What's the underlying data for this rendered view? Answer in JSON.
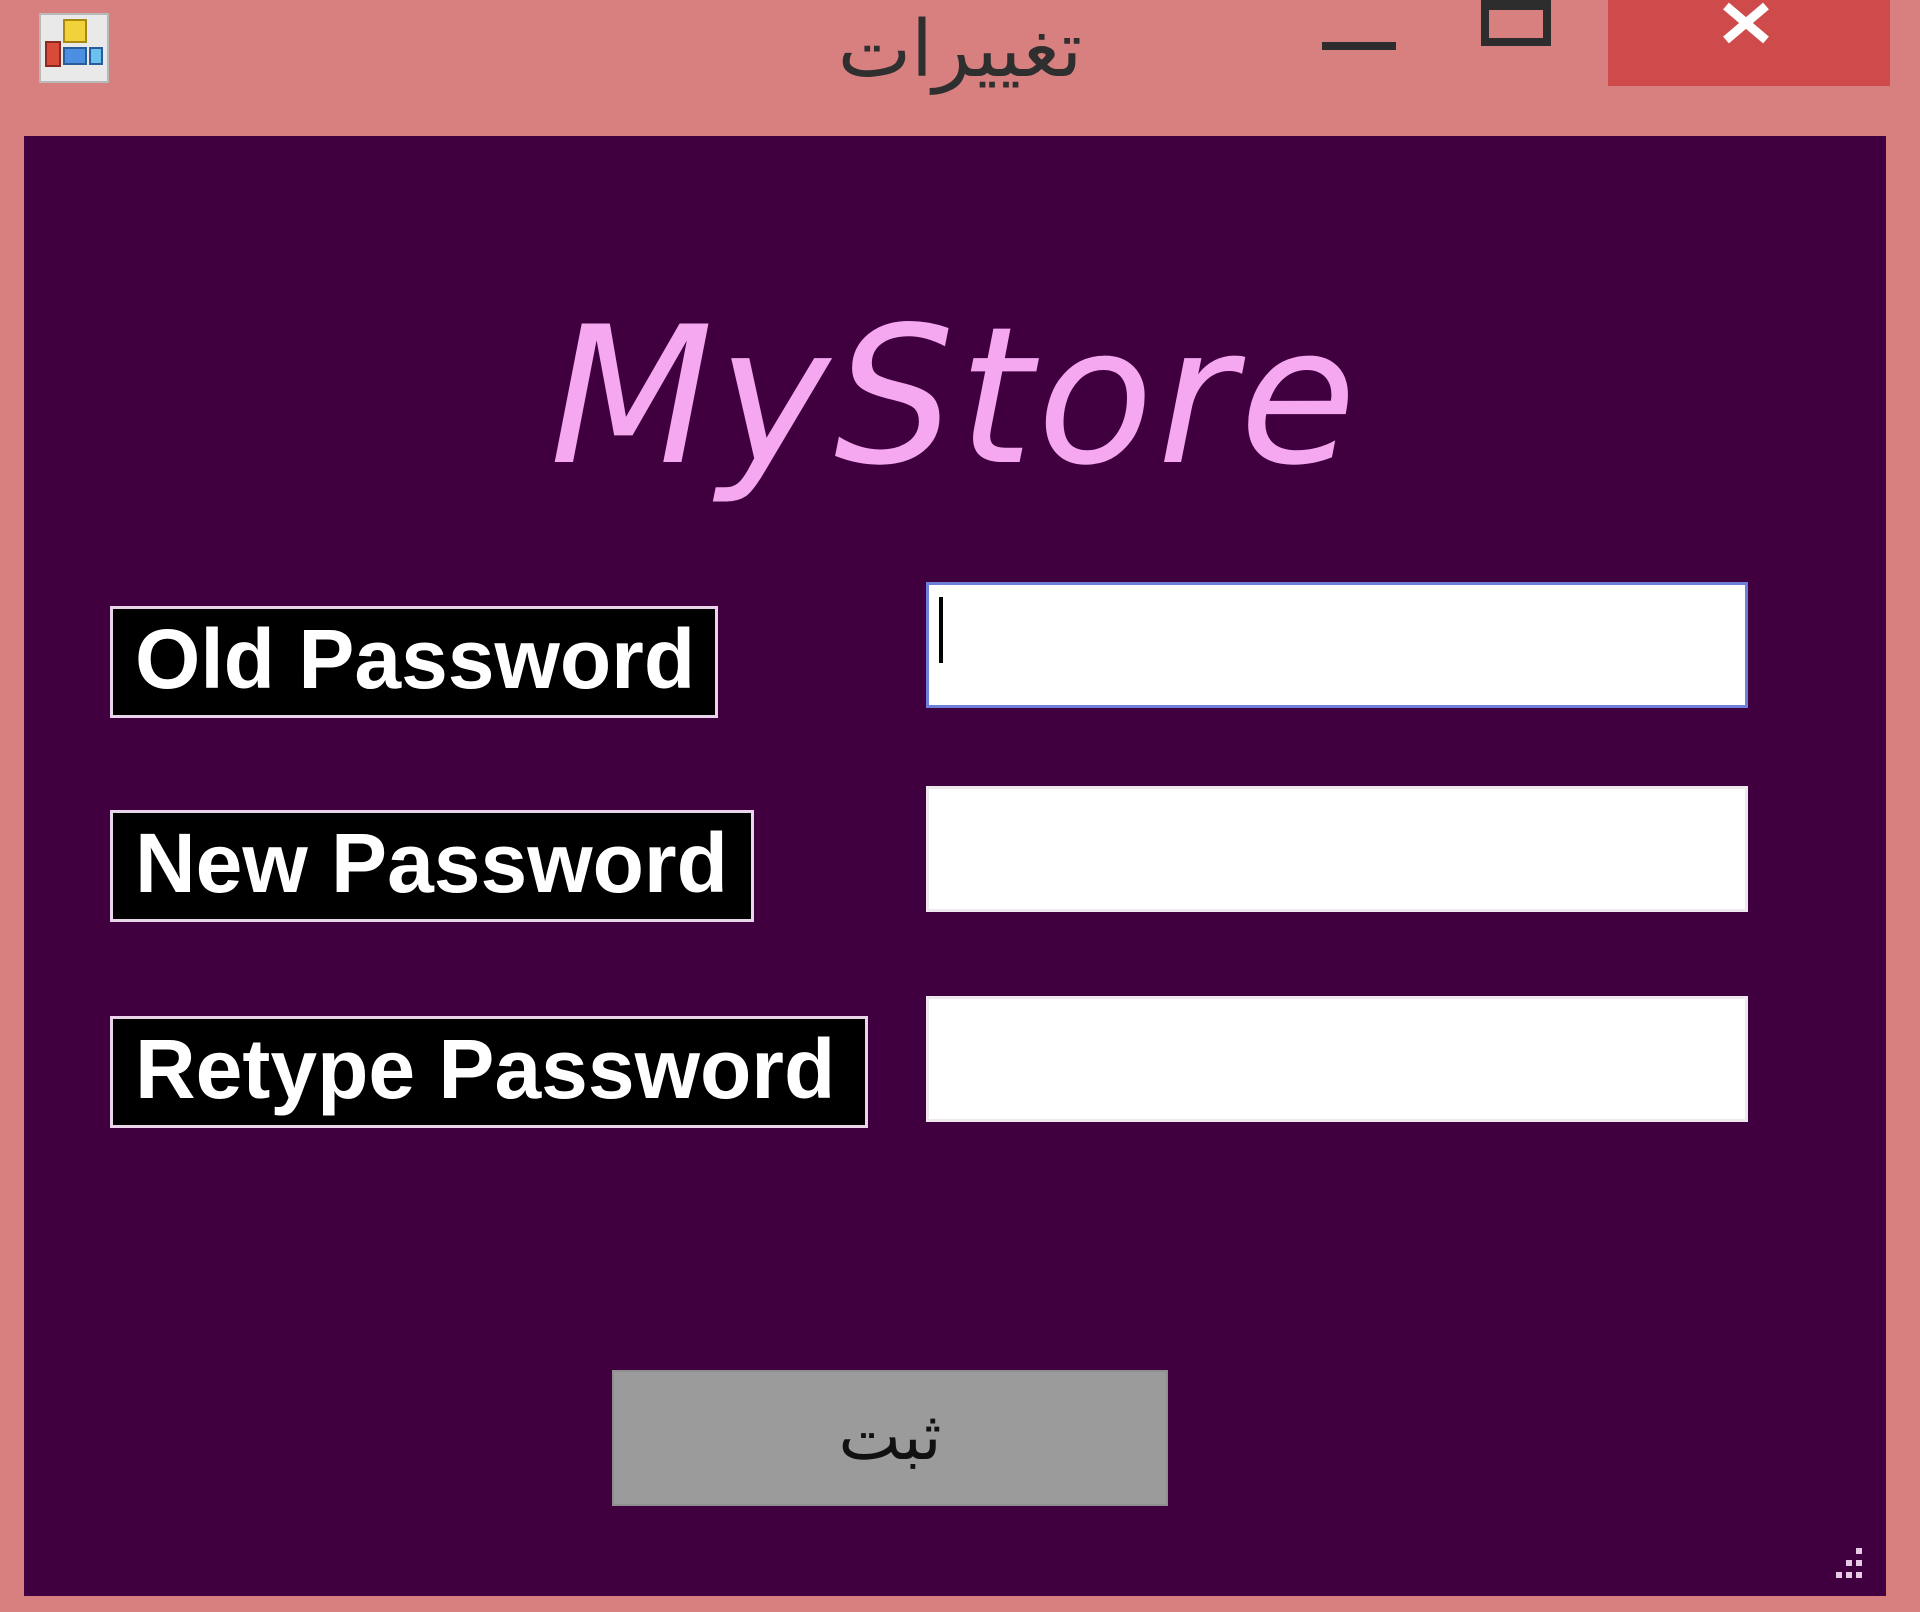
{
  "window": {
    "title": "تغييرات",
    "icons": {
      "app": "app-icon",
      "minimize": "minimize-icon",
      "maximize": "maximize-icon",
      "close": "close-icon",
      "grip": "resize-grip-icon"
    }
  },
  "logo": {
    "text": "MyStore"
  },
  "form": {
    "old_password": {
      "label": "Old Password",
      "value": ""
    },
    "new_password": {
      "label": "New Password",
      "value": ""
    },
    "retype_password": {
      "label": "Retype Password",
      "value": ""
    },
    "submit_label": "ثبت"
  },
  "colors": {
    "frame": "#d8807f",
    "close_button": "#cf4b4b",
    "client_background": "#400040",
    "logo_text": "#f5a8f0",
    "label_background": "#000000",
    "label_text": "#ffffff",
    "field_background": "#ffffff",
    "focused_field_border": "#6d7fd6",
    "submit_background": "#9b9b9b"
  }
}
